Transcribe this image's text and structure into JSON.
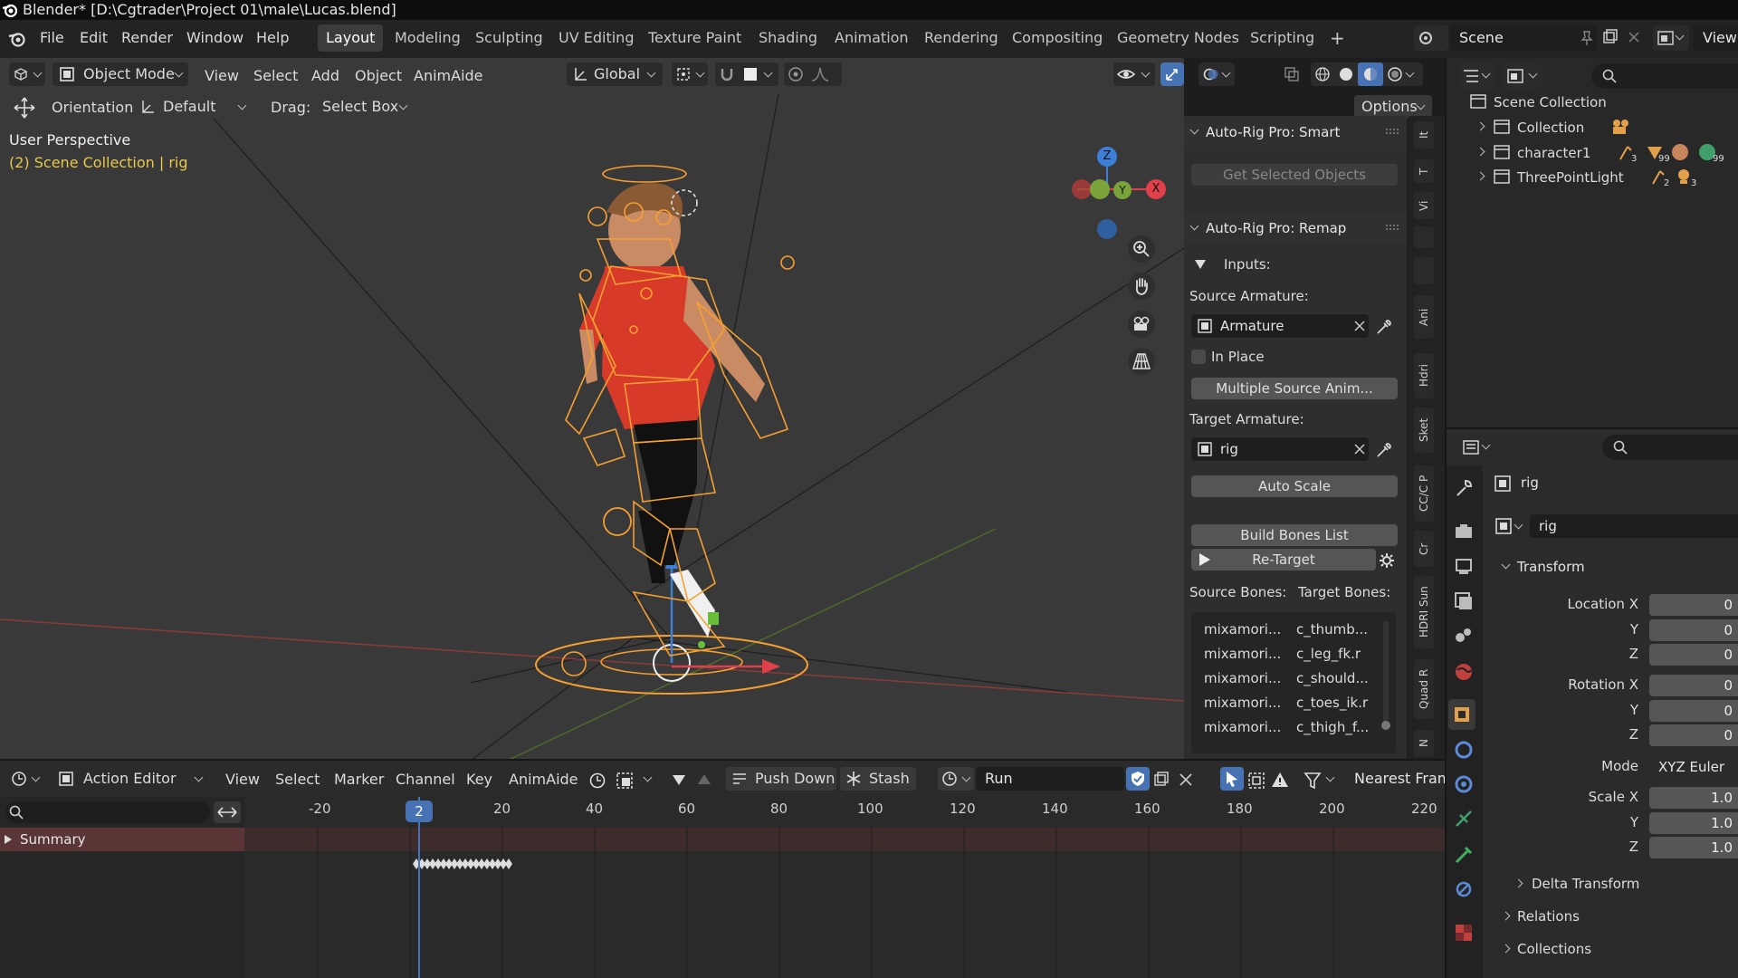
{
  "titlebar": {
    "title": "Blender* [D:\\Cgtrader\\Project 01\\male\\Lucas.blend]"
  },
  "menu": [
    "File",
    "Edit",
    "Render",
    "Window",
    "Help"
  ],
  "workspaces": [
    {
      "label": "Layout",
      "active": true
    },
    {
      "label": "Modeling",
      "active": false
    },
    {
      "label": "Sculpting",
      "active": false
    },
    {
      "label": "UV Editing",
      "active": false
    },
    {
      "label": "Texture Paint",
      "active": false
    },
    {
      "label": "Shading",
      "active": false
    },
    {
      "label": "Animation",
      "active": false
    },
    {
      "label": "Rendering",
      "active": false
    },
    {
      "label": "Compositing",
      "active": false
    },
    {
      "label": "Geometry Nodes",
      "active": false
    },
    {
      "label": "Scripting",
      "active": false
    }
  ],
  "add_workspace": "+",
  "scene": {
    "name": "Scene",
    "view_layer": "ViewL"
  },
  "viewport": {
    "mode": "Object Mode",
    "menus": [
      "View",
      "Select",
      "Add",
      "Object",
      "AnimAide"
    ],
    "transform_orientation": "Global",
    "orientation_label": "Orientation:",
    "orientation_value": "Default",
    "drag_label": "Drag:",
    "drag_value": "Select Box",
    "options": "Options",
    "overlay_line1": "User Perspective",
    "overlay_line2": "(2) Scene Collection | rig",
    "gizmo": {
      "z": "Z",
      "x": "X",
      "y": "Y"
    }
  },
  "npanel": {
    "smart_title": "Auto-Rig Pro: Smart",
    "get_selected": "Get Selected Objects",
    "remap_title": "Auto-Rig Pro: Remap",
    "inputs": "Inputs:",
    "source_armature_label": "Source Armature:",
    "source_armature": "Armature",
    "in_place": "In Place",
    "multiple_source": "Multiple Source Anim...",
    "target_armature_label": "Target Armature:",
    "target_armature": "rig",
    "auto_scale": "Auto Scale",
    "build_bones": "Build Bones List",
    "retarget": "Re-Target",
    "source_bones": "Source Bones:",
    "target_bones": "Target Bones:",
    "bones": [
      {
        "src": "mixamori...",
        "tgt": "c_thumb..."
      },
      {
        "src": "mixamori...",
        "tgt": "c_leg_fk.r"
      },
      {
        "src": "mixamori...",
        "tgt": "c_should..."
      },
      {
        "src": "mixamori...",
        "tgt": "c_toes_ik.r"
      },
      {
        "src": "mixamori...",
        "tgt": "c_thigh_f..."
      }
    ],
    "tabs": [
      "It",
      "T",
      "Vi",
      "Ani",
      "Hdri",
      "Sket",
      "CC/C P",
      "Cr",
      "HDRI Sun",
      "Quad R",
      "N"
    ]
  },
  "outliner": {
    "root": "Scene Collection",
    "items": [
      {
        "label": "Collection",
        "badges": ""
      },
      {
        "label": "character1",
        "badges": "3 99 99"
      },
      {
        "label": "ThreePointLight",
        "badges": "2 3"
      }
    ]
  },
  "properties": {
    "object_name": "rig",
    "data_name": "rig",
    "transform": "Transform",
    "location": {
      "label": "Location X",
      "x": "0",
      "y": "0",
      "z": "0"
    },
    "rotation": {
      "label": "Rotation X",
      "x": "0",
      "y": "0",
      "z": "0"
    },
    "mode_label": "Mode",
    "mode": "XYZ Euler",
    "scale": {
      "label": "Scale X",
      "x": "1.0",
      "y": "1.0",
      "z": "1.0"
    },
    "axis_y": "Y",
    "axis_z": "Z",
    "sections": [
      "Delta Transform",
      "Relations",
      "Collections"
    ]
  },
  "timeline": {
    "editor": "Action Editor",
    "menus": [
      "View",
      "Select",
      "Marker",
      "Channel",
      "Key",
      "AnimAide"
    ],
    "push_down": "Push Down",
    "stash": "Stash",
    "action": "Run",
    "snap": "Nearest Fram",
    "current_frame": "2",
    "ticks": [
      "-20",
      "20",
      "40",
      "60",
      "80",
      "100",
      "120",
      "140",
      "160",
      "180",
      "200",
      "220"
    ],
    "summary": "Summary"
  },
  "colors": {
    "accent": "#4772b3",
    "rig_orange": "#f5a030",
    "x_axis": "#e0404a",
    "y_axis": "#8bc34a",
    "z_axis": "#3d7fd6"
  }
}
